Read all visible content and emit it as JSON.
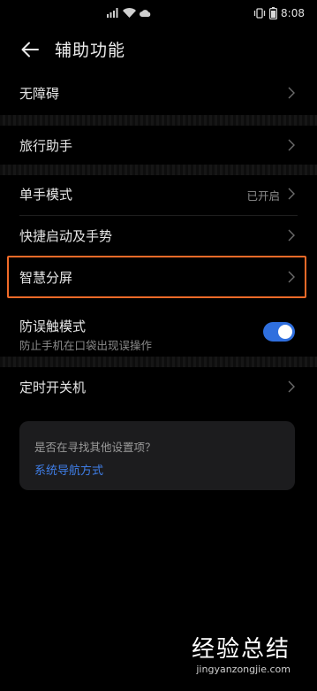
{
  "status_bar": {
    "time": "8:08",
    "icons": [
      "signal-icon",
      "wifi-icon",
      "cloud-icon",
      "vibrate-icon",
      "battery-icon"
    ]
  },
  "header": {
    "title": "辅助功能"
  },
  "rows": {
    "accessibility": {
      "label": "无障碍"
    },
    "travel_assistant": {
      "label": "旅行助手"
    },
    "one_hand_mode": {
      "label": "单手模式",
      "value": "已开启"
    },
    "quick_launch": {
      "label": "快捷启动及手势"
    },
    "smart_split": {
      "label": "智慧分屏"
    },
    "anti_mistouch": {
      "label": "防误触模式",
      "subtitle": "防止手机在口袋出现误操作",
      "enabled": true
    },
    "scheduled_power": {
      "label": "定时开关机"
    }
  },
  "suggestion": {
    "question": "是否在寻找其他设置项？",
    "link": "系统导航方式"
  },
  "watermark": {
    "main": "经验总结",
    "url": "jingyanzongjie.com"
  },
  "colors": {
    "accent": "#2f6fde",
    "highlight": "#f06a28",
    "link": "#3f7ee8"
  }
}
